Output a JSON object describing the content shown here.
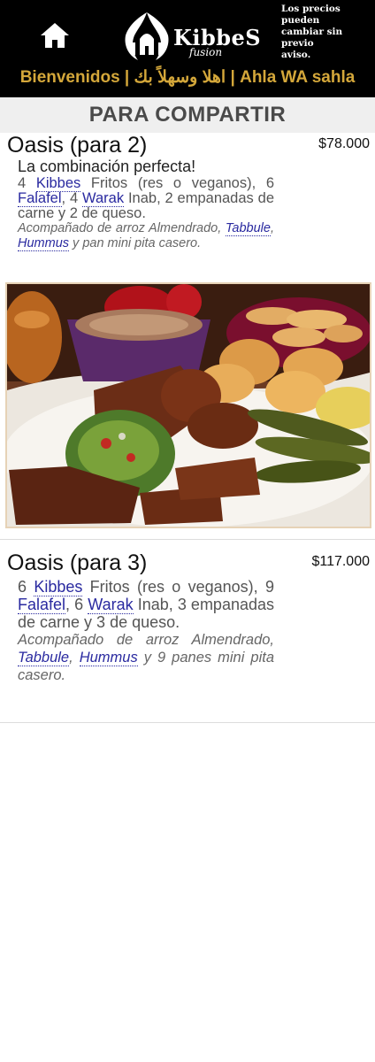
{
  "header": {
    "logo_name": "KibbeS",
    "logo_sub": "fusion",
    "notice": "Los precios pueden\ncambiar sin previo\naviso.",
    "welcome": "Bienvenidos | اهلا وسهلاً بك | Ahla WA sahla",
    "home_icon": "home-icon",
    "colors": {
      "bar": "#000000",
      "welcome_text": "#d4a73a"
    }
  },
  "section": {
    "title": "PARA COMPARTIR"
  },
  "items": [
    {
      "name": "Oasis (para 2)",
      "price": "$78.000",
      "tagline": "La combinación perfecta!",
      "desc_parts": [
        "4 ",
        "Kibbes",
        " Fritos (res o veganos), 6 ",
        "Falafel",
        ", 4 ",
        "Warak",
        " Inab, 2 empanadas de carne y 2 de queso."
      ],
      "side_parts": [
        "Acompañado de arroz Almendrado, ",
        "Tabbule",
        ", ",
        "Hummus",
        " y pan mini pita casero."
      ]
    },
    {
      "name": "Oasis (para 3)",
      "price": "$117.000",
      "desc_parts": [
        "6 ",
        "Kibbes",
        " Fritos (res o veganos), 9 ",
        "Falafel",
        ", 6 ",
        "Warak",
        " Inab, 3 empanadas de carne y 3 de queso."
      ],
      "side_parts": [
        "Acompañado de arroz Almendrado, ",
        "Tabbule",
        ", ",
        "Hummus",
        " y 9 panes mini pita casero."
      ]
    }
  ]
}
